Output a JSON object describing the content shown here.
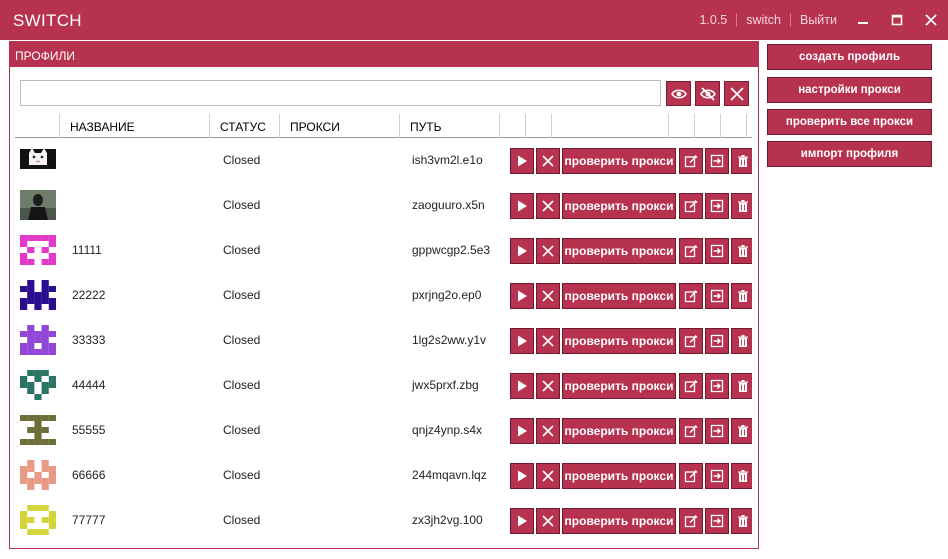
{
  "window": {
    "title": "SWITCH",
    "version": "1.0.5",
    "user": "switch",
    "logout": "Выйти"
  },
  "panel": {
    "header": "ПРОФИЛИ",
    "search_placeholder": "",
    "columns": [
      "НАЗВАНИЕ",
      "СТАТУС",
      "ПРОКСИ",
      "ПУТЬ"
    ]
  },
  "check_proxy_label": "проверить прокси",
  "profiles": [
    {
      "name": "",
      "status": "Closed",
      "proxy": "",
      "path": "ish3vm2l.e1o",
      "avatar": "photo-cat",
      "color": "#ffffff"
    },
    {
      "name": "",
      "status": "Closed",
      "proxy": "",
      "path": "zaoguuro.x5n",
      "avatar": "photo-person",
      "color": "#3a4a3a"
    },
    {
      "name": "11111",
      "status": "Closed",
      "proxy": "",
      "path": "gppwcgp2.5e3",
      "avatar": "identicon",
      "color": "#e438c9"
    },
    {
      "name": "22222",
      "status": "Closed",
      "proxy": "",
      "path": "pxrjng2o.ep0",
      "avatar": "identicon",
      "color": "#2a0e8f"
    },
    {
      "name": "33333",
      "status": "Closed",
      "proxy": "",
      "path": "1lg2s2ww.y1v",
      "avatar": "identicon",
      "color": "#9146d8"
    },
    {
      "name": "44444",
      "status": "Closed",
      "proxy": "",
      "path": "jwx5prxf.zbg",
      "avatar": "identicon",
      "color": "#2b7565"
    },
    {
      "name": "55555",
      "status": "Closed",
      "proxy": "",
      "path": "qnjz4ynp.s4x",
      "avatar": "identicon",
      "color": "#6e6e3a"
    },
    {
      "name": "66666",
      "status": "Closed",
      "proxy": "",
      "path": "244mqavn.lqz",
      "avatar": "identicon",
      "color": "#e89a86"
    },
    {
      "name": "77777",
      "status": "Closed",
      "proxy": "",
      "path": "zx3jh2vg.100",
      "avatar": "identicon",
      "color": "#d4d43a"
    }
  ],
  "sidebar": {
    "create_profile": "создать профиль",
    "proxy_settings": "настройки прокси",
    "check_all_proxies": "проверить все прокси",
    "import_profile": "импорт профиля"
  },
  "colors": {
    "accent": "#b6324f",
    "accent_border": "#6d1a2e"
  }
}
